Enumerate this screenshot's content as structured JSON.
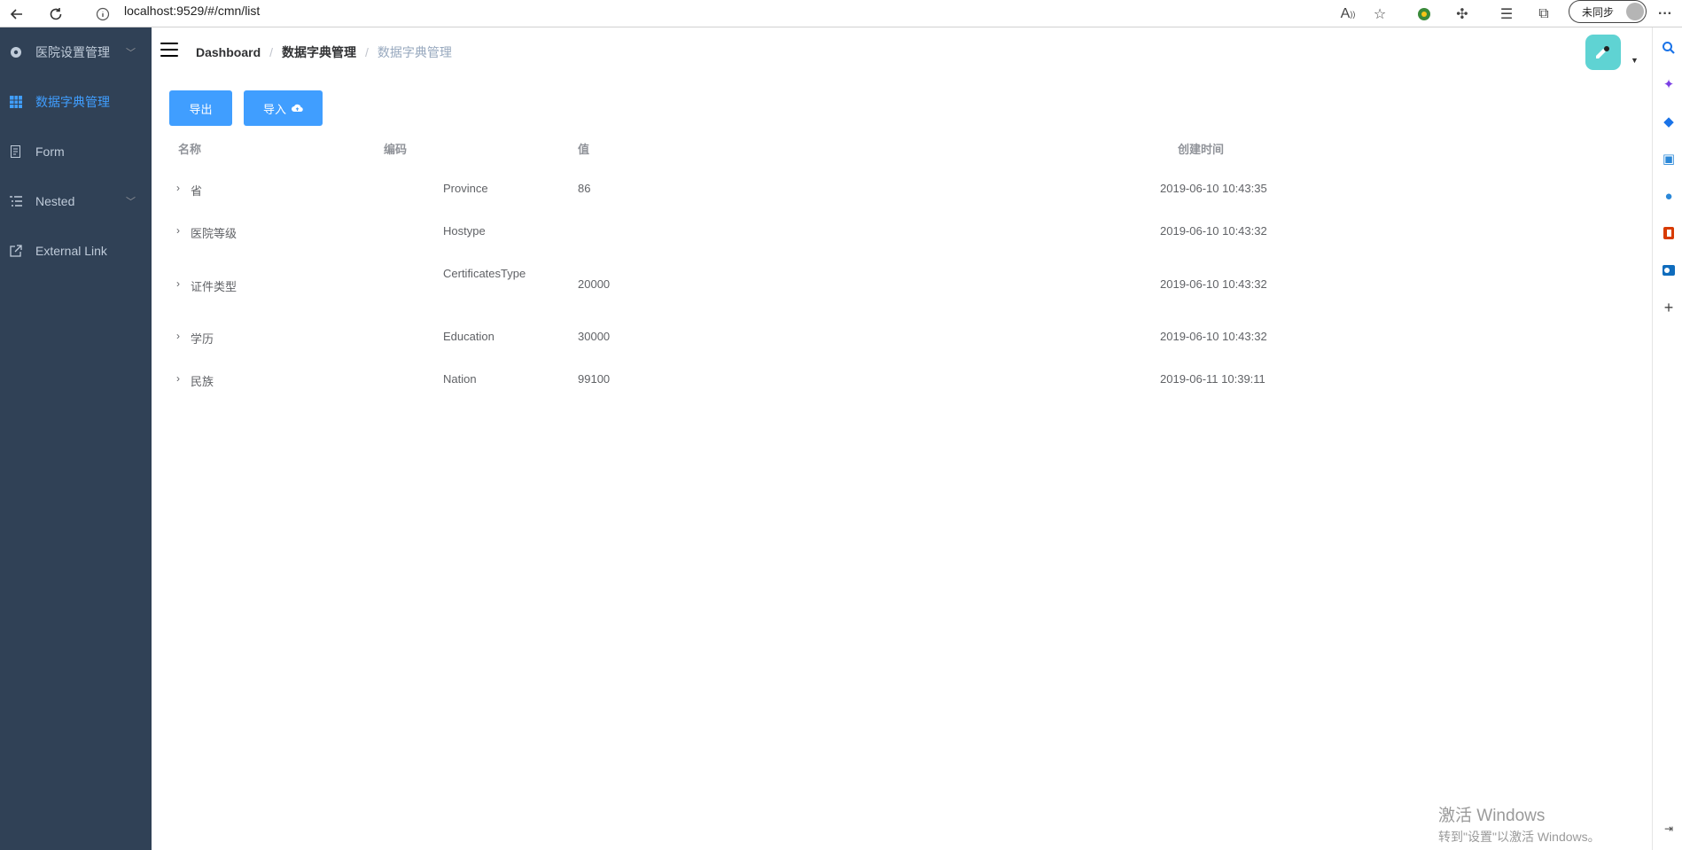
{
  "browser": {
    "url": "localhost:9529/#/cmn/list",
    "sync_label": "未同步",
    "toolbar_icons": [
      "read-aloud-icon",
      "favorite-add-icon",
      "extension-globe-icon",
      "extensions-icon",
      "favorites-icon",
      "collections-icon"
    ],
    "menu_label": "···"
  },
  "sidebar": {
    "items": [
      {
        "label": "医院设置管理",
        "icon": "settings-icon",
        "has_arrow": true
      },
      {
        "label": "数据字典管理",
        "icon": "table-icon",
        "active": true
      },
      {
        "label": "Form",
        "icon": "form-icon"
      },
      {
        "label": "Nested",
        "icon": "nested-icon",
        "has_arrow": true
      },
      {
        "label": "External Link",
        "icon": "external-link-icon"
      }
    ]
  },
  "header": {
    "breadcrumb": [
      "Dashboard",
      "数据字典管理",
      "数据字典管理"
    ]
  },
  "actions": {
    "export_label": "导出",
    "import_label": "导入"
  },
  "table": {
    "headers": {
      "name": "名称",
      "code": "编码",
      "value": "值",
      "created": "创建时间"
    },
    "rows": [
      {
        "name": "省",
        "code": "Province",
        "value": "86",
        "created": "2019-06-10 10:43:35"
      },
      {
        "name": "医院等级",
        "code": "Hostype",
        "value": "",
        "created": "2019-06-10 10:43:32"
      },
      {
        "name": "证件类型",
        "code": "CertificatesType",
        "value": "20000",
        "created": "2019-06-10 10:43:32"
      },
      {
        "name": "学历",
        "code": "Education",
        "value": "30000",
        "created": "2019-06-10 10:43:32"
      },
      {
        "name": "民族",
        "code": "Nation",
        "value": "99100",
        "created": "2019-06-11 10:39:11"
      }
    ]
  },
  "watermark": {
    "line1": "激活 Windows",
    "line2": "转到\"设置\"以激活 Windows。"
  },
  "colors": {
    "sidebar_bg": "#304156",
    "sidebar_text": "#bfcbd9",
    "accent": "#409eff"
  }
}
